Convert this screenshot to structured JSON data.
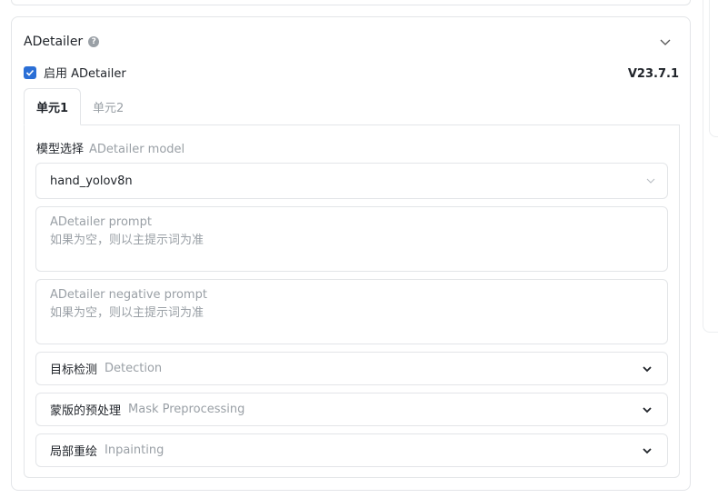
{
  "panel": {
    "title": "ADetailer",
    "help_icon": "?",
    "enable_label": "启用 ADetailer",
    "version": "V23.7.1"
  },
  "tabs": [
    {
      "label": "单元1",
      "active": true
    },
    {
      "label": "单元2",
      "active": false
    }
  ],
  "model": {
    "label": "模型选择",
    "sublabel": "ADetailer model",
    "value": "hand_yolov8n"
  },
  "prompt": {
    "placeholder_line1": "ADetailer prompt",
    "placeholder_line2": "如果为空，则以主提示词为准"
  },
  "negative_prompt": {
    "placeholder_line1": "ADetailer negative prompt",
    "placeholder_line2": "如果为空，则以主提示词为准"
  },
  "sections": [
    {
      "label": "目标检测",
      "sublabel": "Detection"
    },
    {
      "label": "蒙版的预处理",
      "sublabel": "Mask Preprocessing"
    },
    {
      "label": "局部重绘",
      "sublabel": "Inpainting"
    }
  ],
  "colors": {
    "accent": "#2b6fd6",
    "border": "#e3e5e8",
    "muted": "#9aa0a6"
  }
}
